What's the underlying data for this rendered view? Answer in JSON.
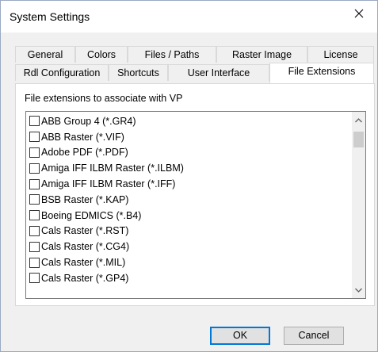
{
  "window": {
    "title": "System Settings"
  },
  "icons": {
    "close": "close-icon",
    "scroll_up": "chevron-up-icon",
    "scroll_down": "chevron-down-icon"
  },
  "tabs_back": [
    "General",
    "Colors",
    "Files / Paths",
    "Raster Image",
    "License"
  ],
  "tabs_front": [
    "Rdl Configuration",
    "Shortcuts",
    "User Interface",
    "File Extensions"
  ],
  "active_tab": "File Extensions",
  "panel": {
    "group_label": "File extensions to associate with VP",
    "items": [
      "ABB Group 4 (*.GR4)",
      "ABB Raster (*.VIF)",
      "Adobe PDF (*.PDF)",
      "Amiga IFF ILBM Raster (*.ILBM)",
      "Amiga IFF ILBM Raster (*.IFF)",
      "BSB Raster (*.KAP)",
      "Boeing EDMICS (*.B4)",
      "Cals Raster (*.RST)",
      "Cals Raster (*.CG4)",
      "Cals Raster (*.MIL)",
      "Cals Raster (*.GP4)"
    ]
  },
  "buttons": {
    "ok": "OK",
    "cancel": "Cancel"
  }
}
